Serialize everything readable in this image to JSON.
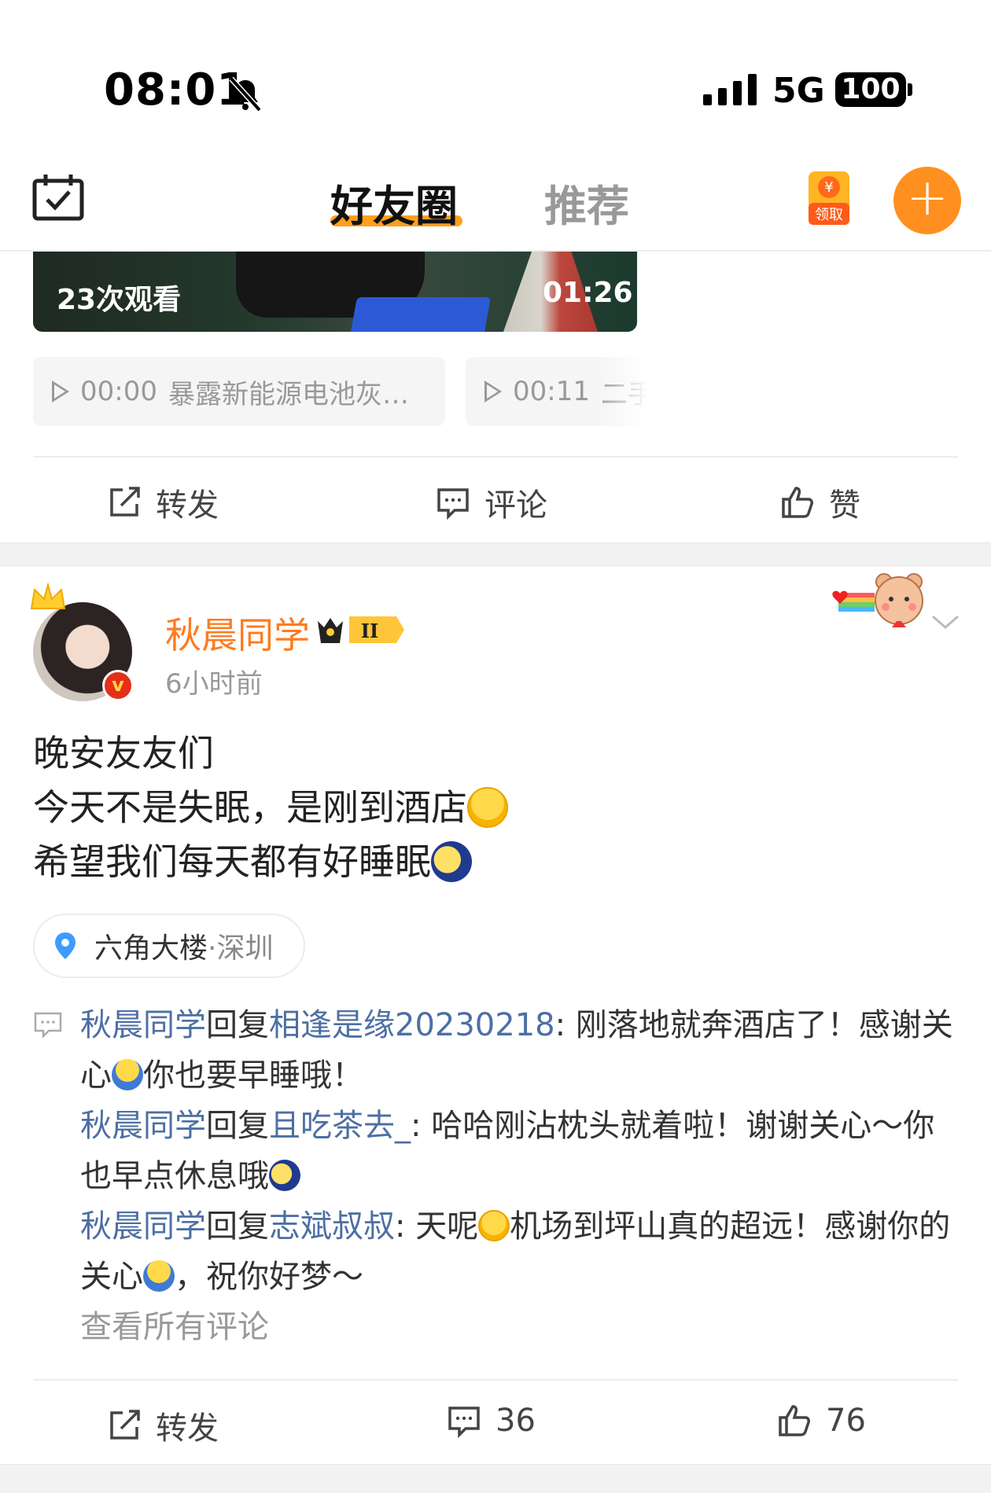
{
  "status_bar": {
    "time": "08:01",
    "network": "5G",
    "battery": "100"
  },
  "header": {
    "tabs": [
      {
        "label": "好友圈",
        "active": true
      },
      {
        "label": "推荐",
        "active": false
      }
    ],
    "redbag_label": "领取",
    "accent": "#ff8f1f"
  },
  "video": {
    "views": "23次观看",
    "duration": "01:26"
  },
  "chapters": [
    {
      "time": "00:00",
      "title": "暴露新能源电池灰…"
    },
    {
      "time": "00:11",
      "title": "二手"
    }
  ],
  "prev_actions": {
    "repost": "转发",
    "comment": "评论",
    "like": "赞"
  },
  "post": {
    "user": "秋晨同学",
    "time": "6小时前",
    "lines": [
      "晚安友友们",
      "今天不是失眠，是刚到酒店",
      "希望我们每天都有好睡眠"
    ],
    "location": {
      "place": "六角大楼",
      "sep": "·",
      "city": "深圳"
    },
    "comments": [
      {
        "author": "秋晨同学",
        "verb": "回复",
        "target": "相逢是缘20230218",
        "text1": ": 刚落地就奔酒店了！感谢关心",
        "text2": "你也要早睡哦！"
      },
      {
        "author": "秋晨同学",
        "verb": "回复",
        "target": "且吃茶去_",
        "text1": ": 哈哈刚沾枕头就着啦！谢谢关心～你也早点休息哦",
        "text2": ""
      },
      {
        "author": "秋晨同学",
        "verb": "回复",
        "target": "志斌叔叔",
        "text1": ": 天呢",
        "text2": "机场到坪山真的超远！感谢你的关心",
        "text3": "，祝你好梦～"
      }
    ],
    "view_all": "查看所有评论",
    "actions": {
      "repost": "转发",
      "comments": "36",
      "likes": "76"
    }
  },
  "icons": {
    "calendar": "calendar-check-icon",
    "plus": "plus-icon",
    "location": "location-pin-icon"
  },
  "colors": {
    "username": "#ff7b1f",
    "link": "#4d6fa3"
  }
}
